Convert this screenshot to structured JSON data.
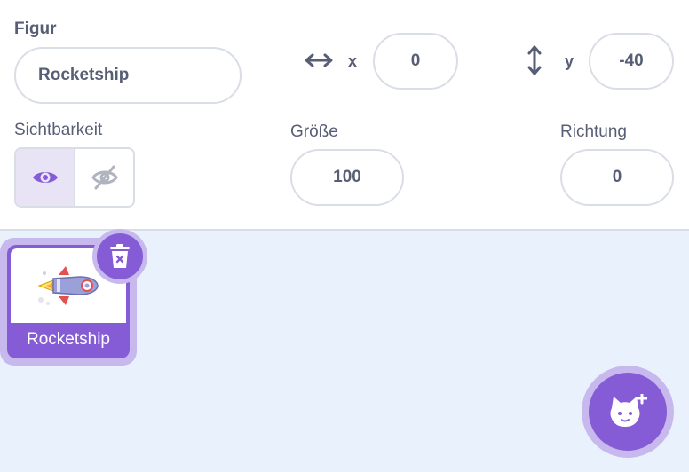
{
  "sprite_info": {
    "name_label": "Figur",
    "name_value": "Rocketship",
    "x_label": "x",
    "x_value": "0",
    "y_label": "y",
    "y_value": "-40",
    "visibility_label": "Sichtbarkeit",
    "size_label": "Größe",
    "size_value": "100",
    "direction_label": "Richtung",
    "direction_value": "0"
  },
  "sprites": [
    {
      "name": "Rocketship",
      "selected": true
    }
  ],
  "icons": {
    "x": "horizontal-arrows-icon",
    "y": "vertical-arrows-icon",
    "show": "eye-icon",
    "hide": "eye-slash-icon",
    "delete": "trash-icon",
    "add_sprite": "cat-plus-icon"
  },
  "colors": {
    "accent": "#855cd6",
    "accent_light": "#c7b8ee",
    "text": "#575e75",
    "border": "#d9dde6",
    "sprite_area_bg": "#e9f1fc"
  }
}
